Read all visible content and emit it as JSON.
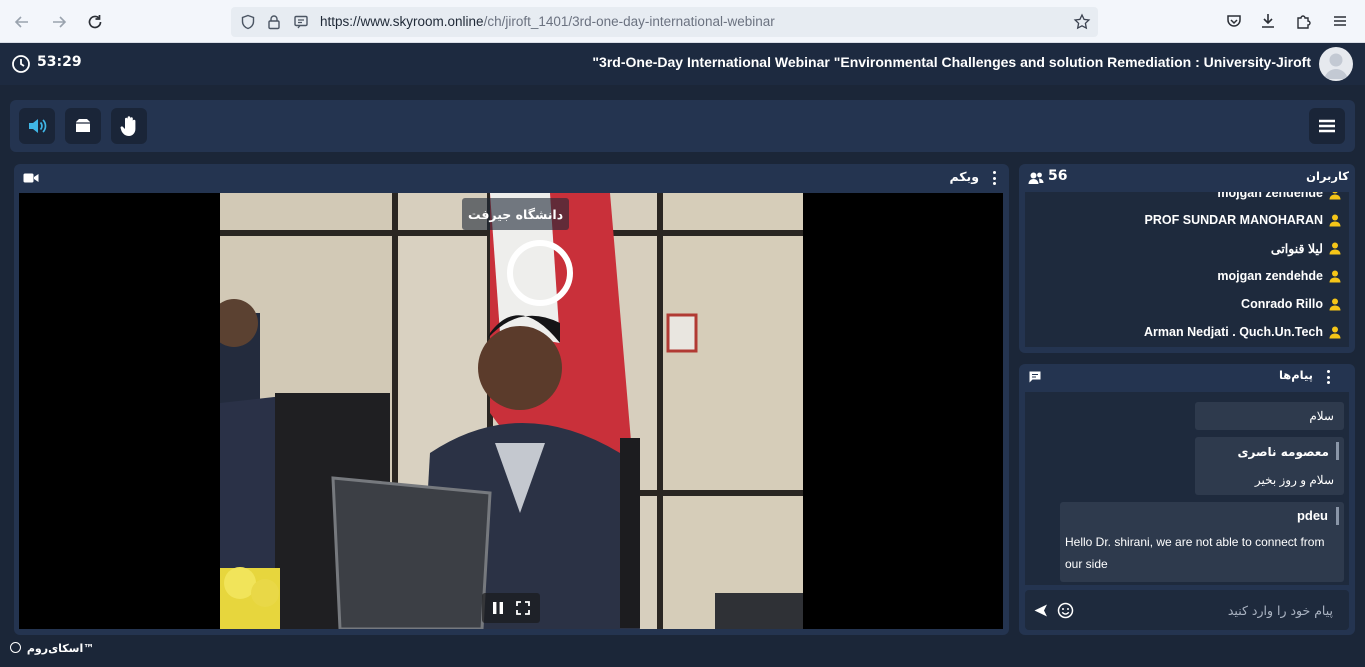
{
  "browser": {
    "url_host": "https://www.skyroom.online",
    "url_path": "/ch/jiroft_1401/3rd-one-day-international-webinar"
  },
  "header": {
    "timer": "53:29",
    "title": "\"3rd-One-Day International Webinar \"Environmental Challenges and solution Remediation : University-Jiroft"
  },
  "webcam": {
    "title": "وبکم",
    "video_caption": "دانشگاه جیرفت"
  },
  "users": {
    "title": "کاربران",
    "count": "56",
    "items": [
      {
        "name": "mojgan zendehde"
      },
      {
        "name": "PROF SUNDAR MANOHARAN"
      },
      {
        "name": "لیلا قنواتی"
      },
      {
        "name": "mojgan zendehde"
      },
      {
        "name": "Conrado Rillo"
      },
      {
        "name": "Arman Nedjati . Quch.Un.Tech"
      }
    ]
  },
  "chat": {
    "title": "پیام‌ها",
    "messages": [
      {
        "sender": "",
        "text": "سلام"
      },
      {
        "sender": "معصومه ناصری",
        "text": "سلام و روز بخیر"
      },
      {
        "sender": "pdeu",
        "text": "Hello Dr. shirani, we are not able to connect from our side"
      }
    ],
    "input_placeholder": "پیام خود را وارد کنید"
  },
  "footer": {
    "brand": "اسکای‌روم™"
  },
  "colors": {
    "accent": "#3fb6e6",
    "user_icon": "#f5c518",
    "panel": "#243450",
    "background": "#1b2638"
  }
}
